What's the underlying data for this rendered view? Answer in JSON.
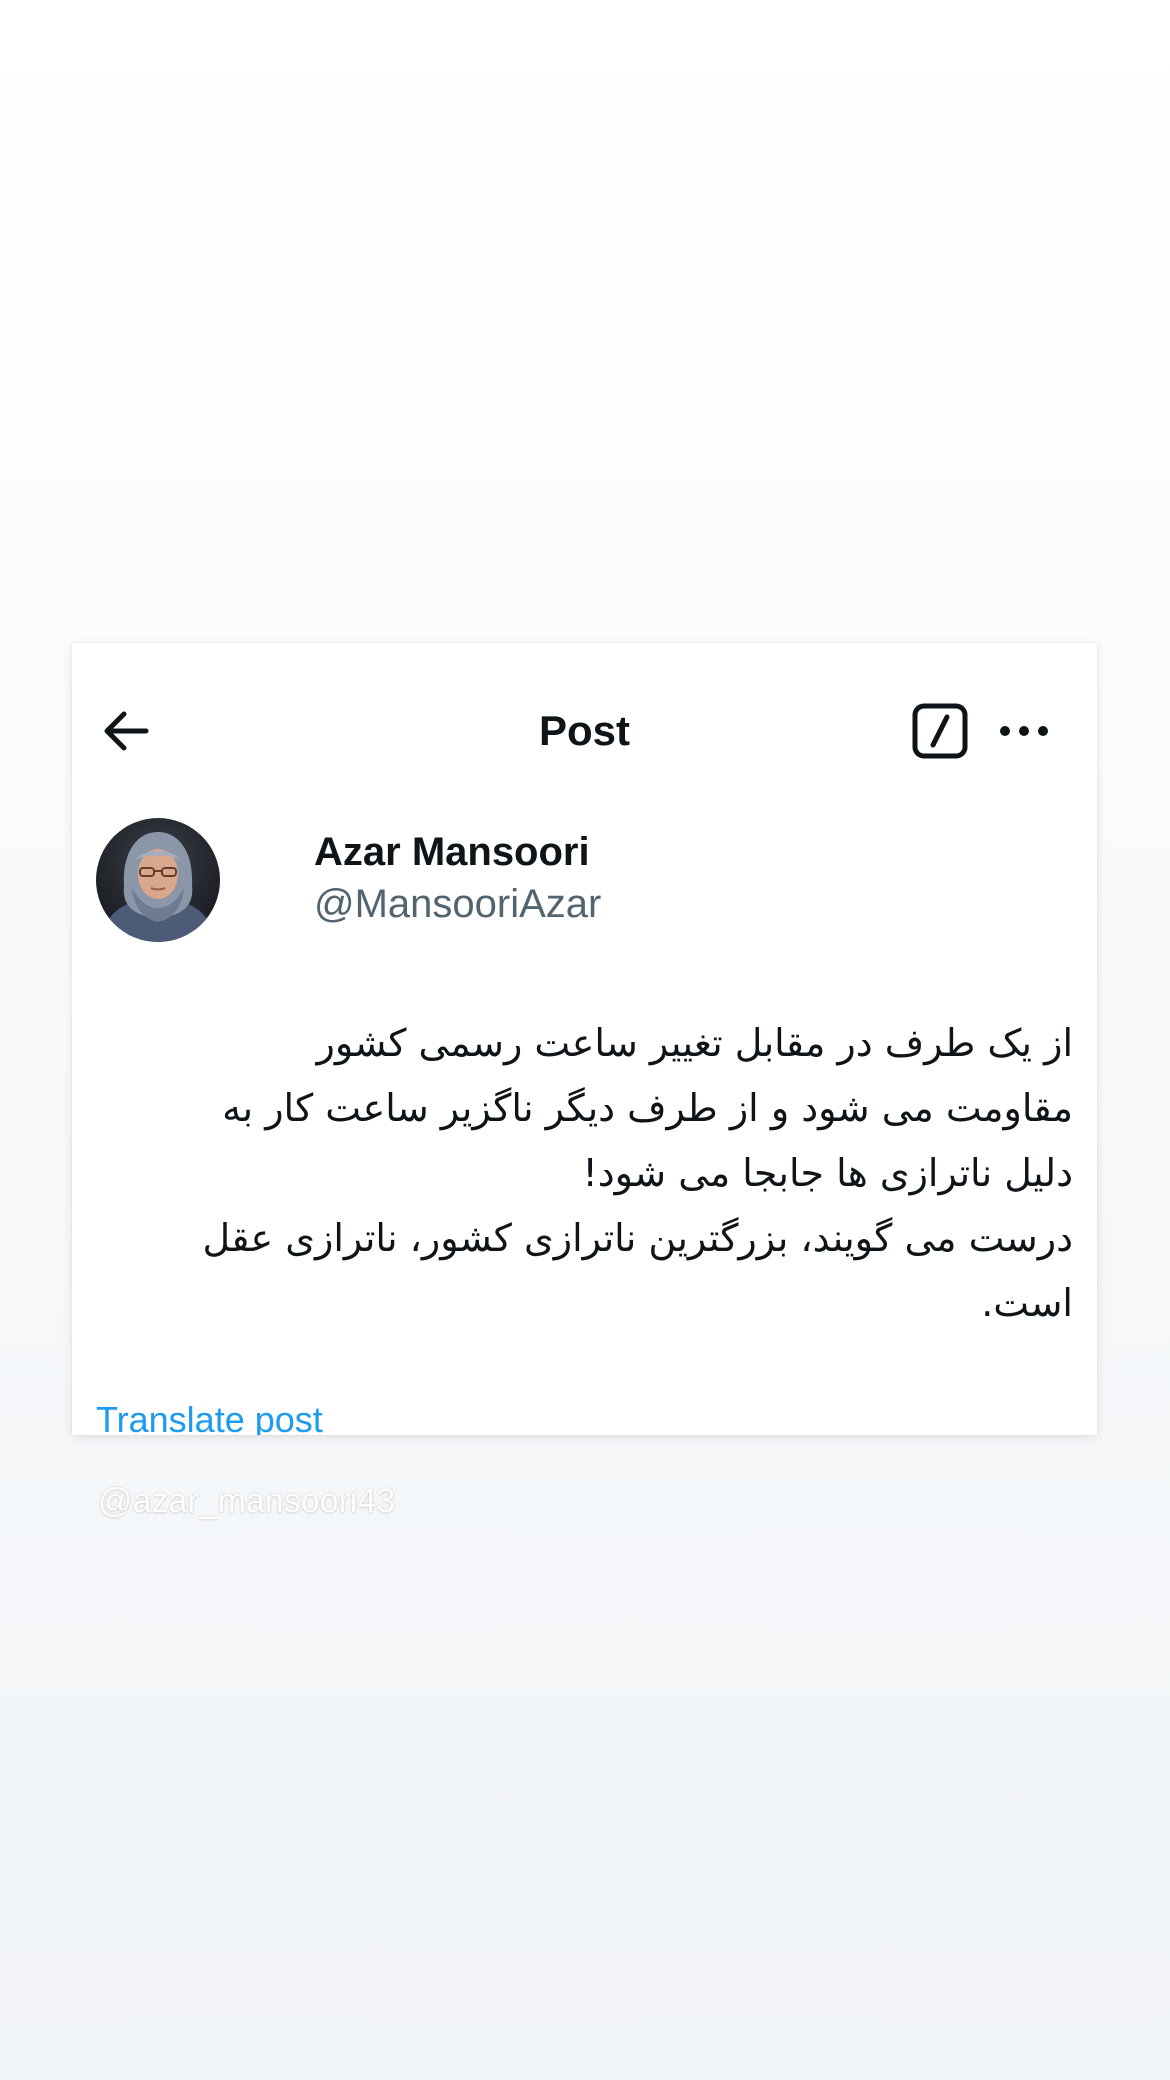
{
  "header": {
    "title": "Post",
    "back_icon": "arrow-left-icon",
    "grok_icon": "grok-slash-icon",
    "more_icon": "more-horizontal-icon"
  },
  "author": {
    "display_name": "Azar Mansoori",
    "handle": "@MansooriAzar",
    "avatar_icon": "avatar-photo"
  },
  "post": {
    "lines": [
      "از یک طرف در مقابل تغییر ساعت رسمی کشور",
      "مقاومت می شود و از طرف دیگر ناگزیر ساعت کار به",
      "دلیل ناترازی ها جابجا می شود!",
      "درست می گویند، بزرگترین ناترازی کشور، ناترازی عقل",
      "است."
    ],
    "translate_label": "Translate post"
  },
  "overlay": {
    "watermark": "@azar_mansoori43"
  },
  "colors": {
    "text_primary": "#0f1419",
    "text_secondary": "#536471",
    "link": "#1d9bf0",
    "card_background": "#ffffff"
  }
}
